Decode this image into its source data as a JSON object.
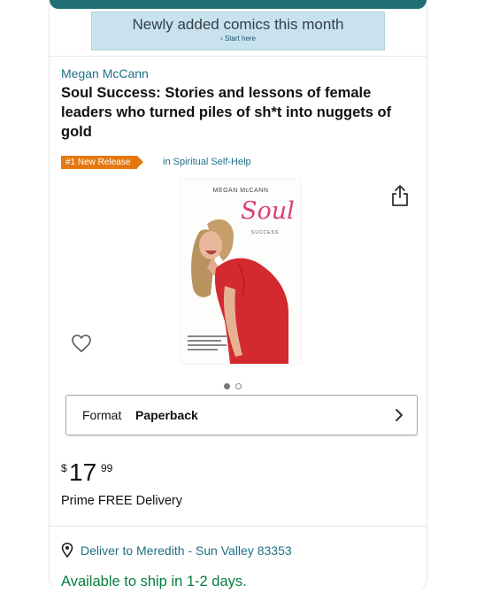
{
  "banner": {
    "title": "Newly added comics this month",
    "link": "› Start here"
  },
  "product": {
    "author": "Megan McCann",
    "title": "Soul Success: Stories and lessons of female leaders who turned piles of sh*t into nuggets of gold",
    "badge": "#1 New Release",
    "category": "in Spiritual Self-Help",
    "cover": {
      "author": "MEGAN McCANN",
      "word1": "Soul",
      "word2": "SUCCESS"
    },
    "image_count": 2,
    "active_image": 1
  },
  "format": {
    "label": "Format",
    "value": "Paperback"
  },
  "price": {
    "currency": "$",
    "whole": "17",
    "fraction": "99"
  },
  "delivery": {
    "prime": "Prime FREE Delivery",
    "deliver_to": "Deliver to Meredith - Sun Valley 83353",
    "availability": "Available to ship in 1-2 days."
  },
  "icons": {
    "share": "share-icon",
    "wishlist": "heart-icon",
    "location": "location-pin-icon",
    "chevron": "chevron-right-icon"
  },
  "colors": {
    "link": "#1e6f87",
    "badge": "#e47911",
    "in_stock": "#067d3e",
    "banner": "#c9e3ee",
    "topbar": "#1f6f75"
  }
}
